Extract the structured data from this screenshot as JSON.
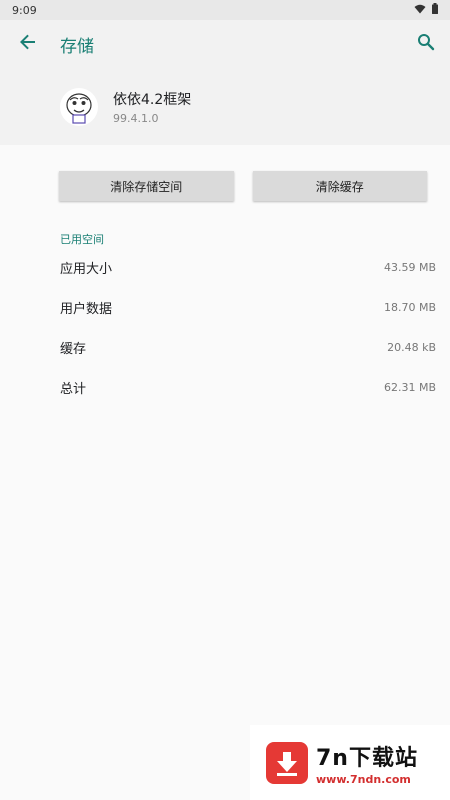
{
  "status_bar": {
    "time": "9:09"
  },
  "app_bar": {
    "title": "存储"
  },
  "app": {
    "name": "依依4.2框架",
    "version": "99.4.1.0"
  },
  "buttons": {
    "clear_storage": "清除存储空间",
    "clear_cache": "清除缓存"
  },
  "section": {
    "title": "已用空间"
  },
  "rows": [
    {
      "label": "应用大小",
      "value": "43.59 MB"
    },
    {
      "label": "用户数据",
      "value": "18.70 MB"
    },
    {
      "label": "缓存",
      "value": "20.48 kB"
    },
    {
      "label": "总计",
      "value": "62.31 MB"
    }
  ],
  "watermark": {
    "main": "7n下载站",
    "sub": "www.7ndn.com"
  },
  "icons": {
    "back": "arrow-left-icon",
    "search": "search-icon",
    "wifi": "wifi-icon",
    "battery": "battery-icon",
    "app": "app-icon",
    "download": "download-icon"
  },
  "colors": {
    "accent": "#1a7f74",
    "watermark_red": "#e53935"
  }
}
